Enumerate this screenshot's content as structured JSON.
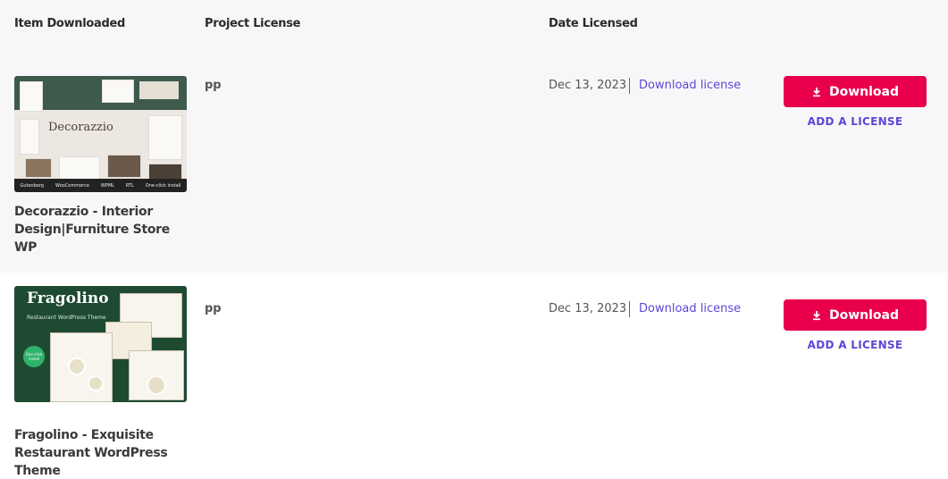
{
  "header": {
    "item_downloaded": "Item Downloaded",
    "project_license": "Project License",
    "date_licensed": "Date Licensed"
  },
  "items": [
    {
      "title": "Decorazzio - Interior Design|Furniture Store WP",
      "thumb_brand": "Decorazzio",
      "thumb_tags": [
        "Gutenberg",
        "WooCommerce",
        "WPML",
        "RTL",
        "One-click install"
      ],
      "project": "pp",
      "date": "Dec 13, 2023",
      "download_license_label": "Download license",
      "download_label": "Download",
      "add_license_label": "ADD A LICENSE"
    },
    {
      "title": "Fragolino - Exquisite Restaurant WordPress Theme",
      "thumb_brand": "Fragolino",
      "thumb_sub": "Restaurant WordPress Theme",
      "thumb_badge": "One-click install",
      "project": "pp",
      "date": "Dec 13, 2023",
      "download_license_label": "Download license",
      "download_label": "Download",
      "add_license_label": "ADD A LICENSE"
    }
  ],
  "colors": {
    "download_button": "#e8004c",
    "link": "#5b48d6",
    "row_alt_bg": "#f7f7f9"
  },
  "icons": {
    "download": "download-icon"
  }
}
